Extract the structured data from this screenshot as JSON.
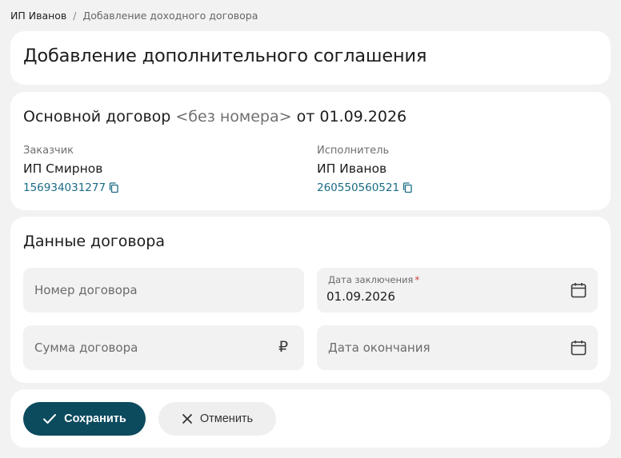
{
  "breadcrumb": {
    "root": "ИП Иванов",
    "separator": "/",
    "current": "Добавление доходного договора"
  },
  "page": {
    "title": "Добавление дополнительного соглашения"
  },
  "contract": {
    "heading_prefix": "Основной договор",
    "number": "<без номера>",
    "date_prefix": "от",
    "date": "01.09.2026",
    "customer": {
      "label": "Заказчик",
      "name": "ИП Смирнов",
      "inn": "156934031277"
    },
    "executor": {
      "label": "Исполнитель",
      "name": "ИП Иванов",
      "inn": "260550560521"
    }
  },
  "form": {
    "title": "Данные договора",
    "number_placeholder": "Номер договора",
    "date_label": "Дата заключения",
    "date_required_mark": "*",
    "date_value": "01.09.2026",
    "sum_placeholder": "Сумма договора",
    "currency_symbol": "₽",
    "end_date_placeholder": "Дата окончания"
  },
  "actions": {
    "save_label": "Сохранить",
    "cancel_label": "Отменить"
  },
  "colors": {
    "primary": "#0c4a5e",
    "link": "#1a6b86",
    "required": "#d0342c"
  },
  "icons": {
    "copy": "copy-icon",
    "calendar": "calendar-icon",
    "check": "check-icon",
    "close": "close-icon"
  }
}
